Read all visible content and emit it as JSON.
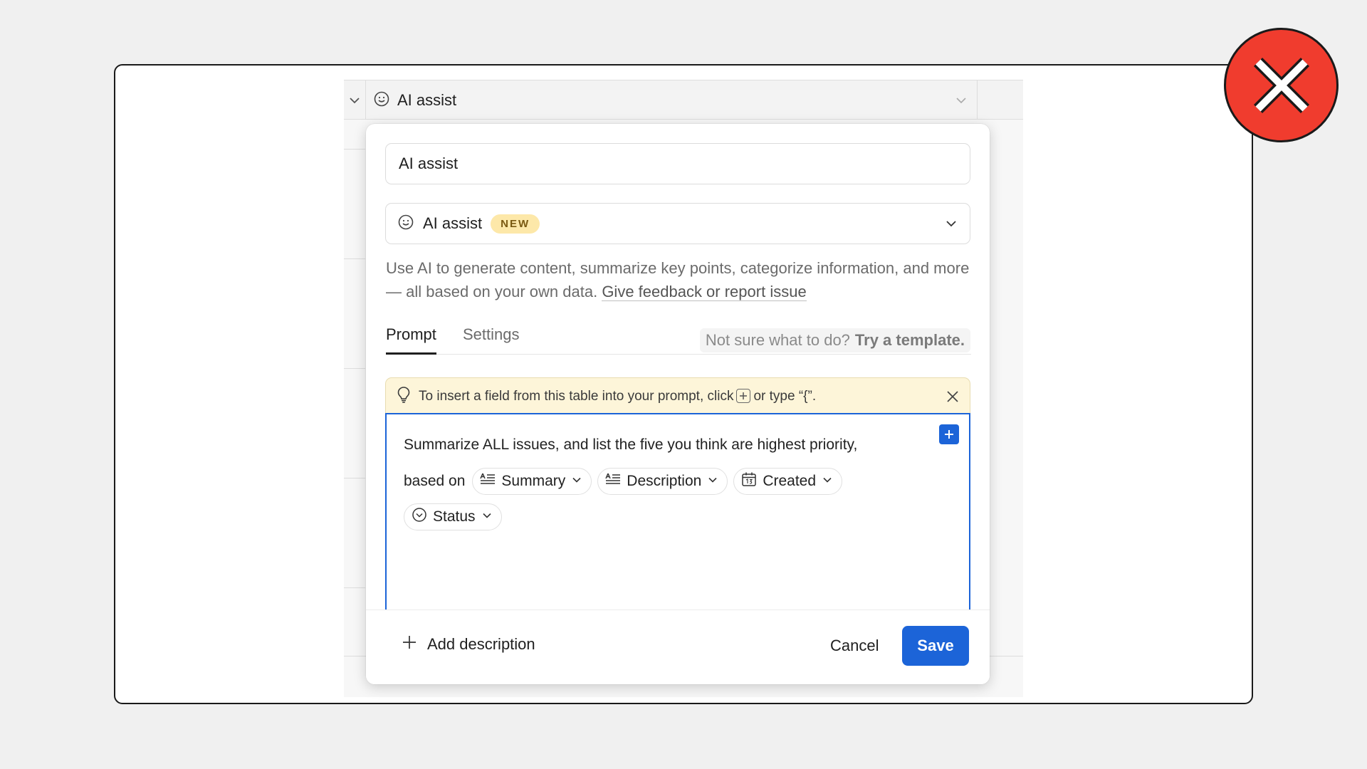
{
  "column_header": {
    "label": "AI assist",
    "icon": "smiley-icon"
  },
  "popup": {
    "field_name_value": "AI assist",
    "field_type": {
      "label": "AI assist",
      "badge": "NEW",
      "icon": "smiley-icon"
    },
    "description": {
      "text": "Use AI to generate content, summarize key points, categorize information, and more — all based on your own data.",
      "link": "Give feedback or report issue"
    },
    "tabs": {
      "prompt": "Prompt",
      "settings": "Settings"
    },
    "template_hint": {
      "text": "Not sure what to do?",
      "link": "Try a template."
    },
    "tip": {
      "before": "To insert a field from this table into your prompt, click",
      "after": "or type “{”."
    },
    "prompt": {
      "line1": "Summarize ALL issues, and list the five you think are highest priority,",
      "based_on": "based on",
      "chips": [
        {
          "label": "Summary",
          "icon": "text-lines-icon"
        },
        {
          "label": "Description",
          "icon": "text-lines-icon"
        },
        {
          "label": "Created",
          "icon": "calendar-icon"
        },
        {
          "label": "Status",
          "icon": "status-circle-icon"
        }
      ]
    },
    "footer": {
      "add_description": "Add description",
      "cancel": "Cancel",
      "save": "Save"
    }
  },
  "colors": {
    "accent": "#1c64d8",
    "reject_badge": "#f03c2e",
    "tip_background": "#fdf5d9",
    "new_badge": "#fde8a9"
  }
}
